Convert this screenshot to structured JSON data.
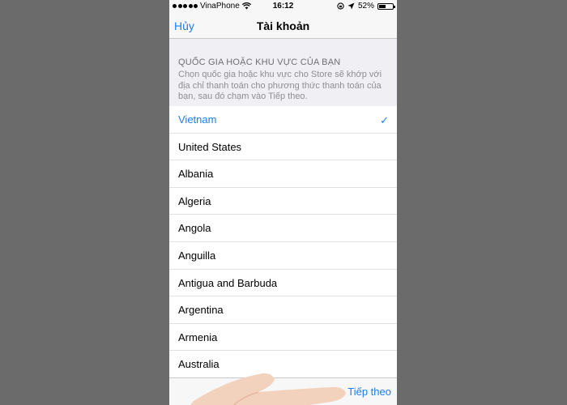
{
  "status": {
    "carrier": "VinaPhone",
    "time": "16:12",
    "battery_text": "52%",
    "battery_level": 0.52
  },
  "nav": {
    "left_label": "Hủy",
    "title": "Tài khoản"
  },
  "section": {
    "header": "QUỐC GIA HOẶC KHU VỰC CỦA BẠN",
    "description": "Chọn quốc gia hoặc khu vực cho Store sẽ khớp với địa chỉ thanh toán cho phương thức thanh toán của bạn, sau đó chạm vào Tiếp theo."
  },
  "countries": [
    {
      "label": "Vietnam",
      "selected": true
    },
    {
      "label": "United States",
      "selected": false
    },
    {
      "label": "Albania",
      "selected": false
    },
    {
      "label": "Algeria",
      "selected": false
    },
    {
      "label": "Angola",
      "selected": false
    },
    {
      "label": "Anguilla",
      "selected": false
    },
    {
      "label": "Antigua and Barbuda",
      "selected": false
    },
    {
      "label": "Argentina",
      "selected": false
    },
    {
      "label": "Armenia",
      "selected": false
    },
    {
      "label": "Australia",
      "selected": false
    }
  ],
  "toolbar": {
    "next_label": "Tiếp theo"
  },
  "icons": {
    "wifi": "wifi-icon",
    "location": "location-arrow-icon",
    "lock_rotation": "rotation-lock-icon",
    "checkmark": "checkmark-icon"
  },
  "colors": {
    "accent": "#1a7ef5",
    "background": "#efeff4"
  }
}
